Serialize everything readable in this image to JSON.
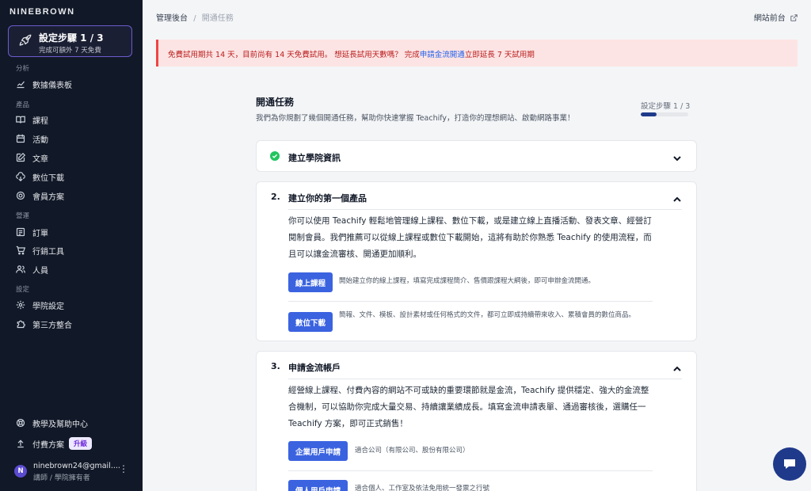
{
  "sidebar": {
    "brand": "NINEBROWN",
    "setup": {
      "title": "設定步驟 1 / 3",
      "subtitle": "完成可額外 7 天免費"
    },
    "sections": {
      "analytics": "分析",
      "products": "產品",
      "operations": "營運",
      "settings": "設定"
    },
    "items": {
      "dashboard": "數據儀表板",
      "courses": "課程",
      "events": "活動",
      "articles": "文章",
      "downloads": "數位下載",
      "membership": "會員方案",
      "orders": "訂單",
      "marketing": "行銷工具",
      "people": "人員",
      "academy_settings": "學院設定",
      "integrations": "第三方整合",
      "help": "教學及幫助中心",
      "billing": "付費方案",
      "upgrade_badge": "升級"
    },
    "user": {
      "initial": "N",
      "email": "ninebrown24@gmail....",
      "role": "講師 / 學院擁有者"
    }
  },
  "topbar": {
    "crumb_root": "管理後台",
    "crumb_sep": "/",
    "crumb_current": "開通任務",
    "site_link": "網站前台"
  },
  "alert": {
    "text_before": "免費試用期共 14 天，目前尚有 14 天免費試用。 想延長試用天數嗎？ 完成",
    "link": "申請金流開通",
    "text_after": "立即延長 7 天試用期"
  },
  "main": {
    "title": "開通任務",
    "subtitle": "我們為你規劃了幾個開通任務，幫助你快速掌握 Teachify，打造你的理想網站、啟動網路事業！",
    "progress_label": "設定步驟 1 / 3",
    "progress_fraction": 0.333
  },
  "cards": {
    "c1": {
      "title": "建立學院資訊"
    },
    "c2": {
      "num": "2.",
      "title": "建立你的第一個產品",
      "body": "你可以使用 Teachify 輕鬆地管理線上課程、數位下載，或是建立線上直播活動、發表文章、經營訂閱制會員。我們推薦可以從線上課程或數位下載開始，這將有助於你熟悉 Teachify 的使用流程，而且可以讓金流審核、開通更加順利。",
      "opt1_btn": "線上課程",
      "opt1_desc": "開始建立你的線上課程，填寫完成課程簡介、售價跟課程大綱後，即可申辦金流開通。",
      "opt2_btn": "數位下載",
      "opt2_desc": "簡報、文件、模板、設計素材或任何格式的文件，都可立即成持續帶來收入、累積會員的數位商品。"
    },
    "c3": {
      "num": "3.",
      "title": "申請金流帳戶",
      "body": "經營線上課程、付費內容的網站不可或缺的重要環節就是金流，Teachify 提供穩定、強大的金流整合機制，可以協助你完成大量交易、持續讓業績成長。填寫金流申請表單、通過審核後，選購任一Teachify 方案，即可正式銷售！",
      "opt1_btn": "企業用戶申請",
      "opt1_desc": "適合公司（有限公司、股份有限公司）",
      "opt2_btn": "個人用戶申請",
      "opt2_desc": "適合個人、工作室及依法免用統一發票之行號"
    }
  }
}
